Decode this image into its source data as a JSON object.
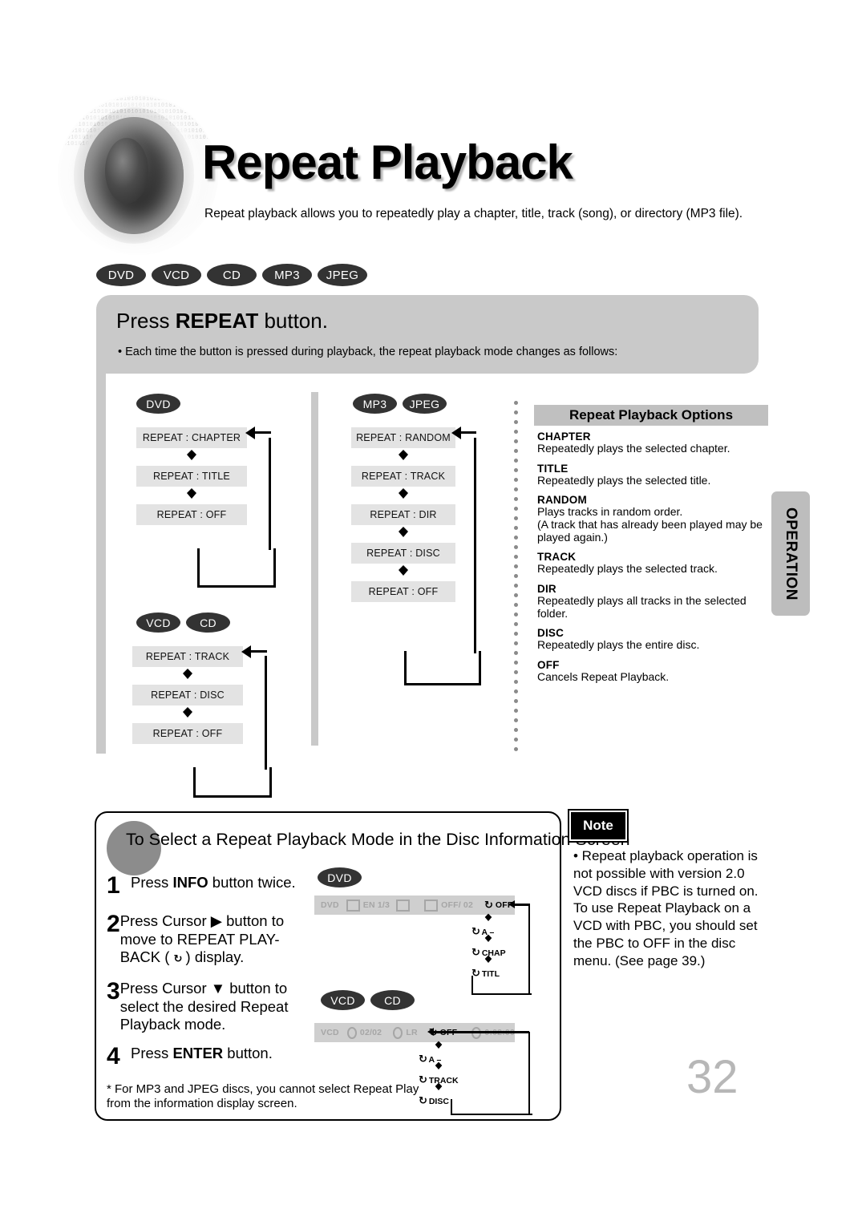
{
  "header": {
    "title": "Repeat Playback",
    "subtitle": "Repeat playback allows you to repeatedly play a chapter, title, track (song), or directory (MP3 file).",
    "disc_badges": [
      "DVD",
      "VCD",
      "CD",
      "MP3",
      "JPEG"
    ]
  },
  "repeat_panel": {
    "title_prefix": "Press ",
    "title_bold": "REPEAT",
    "title_suffix": " button.",
    "note": "• Each time the button is pressed during playback, the repeat playback mode changes as follows:"
  },
  "flows": [
    {
      "badges": [
        "DVD"
      ],
      "steps": [
        "REPEAT : CHAPTER",
        "REPEAT : TITLE",
        "REPEAT : OFF"
      ]
    },
    {
      "badges": [
        "VCD",
        "CD"
      ],
      "steps": [
        "REPEAT : TRACK",
        "REPEAT : DISC",
        "REPEAT : OFF"
      ]
    },
    {
      "badges": [
        "MP3",
        "JPEG"
      ],
      "steps": [
        "REPEAT : RANDOM",
        "REPEAT : TRACK",
        "REPEAT : DIR",
        "REPEAT : DISC",
        "REPEAT : OFF"
      ]
    }
  ],
  "options": {
    "header": "Repeat Playback Options",
    "items": [
      {
        "term": "CHAPTER",
        "desc": "Repeatedly plays the selected chapter."
      },
      {
        "term": "TITLE",
        "desc": "Repeatedly plays the selected title."
      },
      {
        "term": "RANDOM",
        "desc": "Plays tracks in random order.\n(A track that has already been played may be played again.)"
      },
      {
        "term": "TRACK",
        "desc": "Repeatedly plays the selected track."
      },
      {
        "term": "DIR",
        "desc": "Repeatedly plays all tracks in the selected folder."
      },
      {
        "term": "DISC",
        "desc": "Repeatedly plays the entire disc."
      },
      {
        "term": "OFF",
        "desc": "Cancels Repeat Playback."
      }
    ]
  },
  "side_tab": {
    "label": "OPERATION"
  },
  "info_box": {
    "heading": "To Select a Repeat Playback Mode in the Disc Information Screen",
    "steps": [
      {
        "num": "1",
        "pre": "Press ",
        "bold": "INFO",
        "post": " button twice."
      },
      {
        "num": "2",
        "pre": "Press Cursor ▶ button to move to REPEAT PLAY-BACK ( ",
        "bold": "↻",
        "post": " ) display."
      },
      {
        "num": "3",
        "pre": "Press Cursor ▼ button to select the desired Repeat Playback mode.",
        "bold": "",
        "post": ""
      },
      {
        "num": "4",
        "pre": "Press ",
        "bold": "ENTER",
        "post": " button."
      }
    ],
    "footnote": "* For MP3 and JPEG discs, you cannot select Repeat Play from the information display screen.",
    "dvd_display": {
      "badges": [
        "DVD"
      ],
      "fields": [
        "DVD",
        "EN 1/3",
        "OFF/  02"
      ],
      "repeat_value": "OFF",
      "chain": [
        "A –",
        "CHAP",
        "TITL"
      ]
    },
    "vcd_display": {
      "badges": [
        "VCD",
        "CD"
      ],
      "fields": [
        "VCD",
        "02/02",
        "LR"
      ],
      "repeat_value": "OFF",
      "time": "0:02:00",
      "chain": [
        "A –",
        "TRACK",
        "DISC"
      ]
    }
  },
  "note": {
    "badge": "Note",
    "text": "• Repeat playback operation is not possible with version 2.0 VCD discs if PBC is turned on. To use Repeat Playback on a VCD with PBC, you should set the PBC to OFF in the disc menu. (See page 39.)"
  },
  "page_number": "32",
  "colors": {
    "panel_gray": "#c9c9c9",
    "box_gray": "#e3e3e3",
    "badge_dark": "#333333",
    "header_gray": "#c0c0c0",
    "page_number_gray": "#b7b7b7"
  }
}
